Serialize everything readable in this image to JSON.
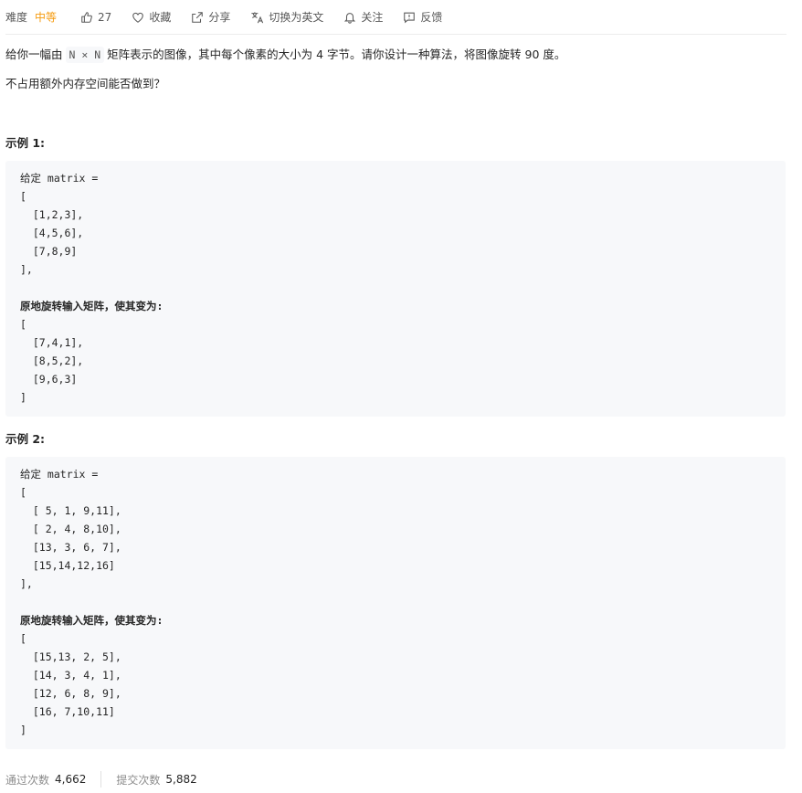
{
  "toolbar": {
    "difficulty_label": "难度",
    "difficulty_value": "中等",
    "likes": "27",
    "favorite": "收藏",
    "share": "分享",
    "switch_lang": "切换为英文",
    "follow": "关注",
    "feedback": "反馈",
    "difficulty_color": "#f59b0f"
  },
  "description": {
    "part1": "给你一幅由",
    "code": "N × N",
    "part2": "矩阵表示的图像，其中每个像素的大小为 4 字节。请你设计一种算法，将图像旋转 90 度。",
    "line2": "不占用额外内存空间能否做到？"
  },
  "examples": [
    {
      "title": "示例 1:",
      "lines": [
        {
          "text": "给定 matrix =",
          "bold": false
        },
        {
          "text": "[",
          "bold": false
        },
        {
          "text": "  [1,2,3],",
          "bold": false
        },
        {
          "text": "  [4,5,6],",
          "bold": false
        },
        {
          "text": "  [7,8,9]",
          "bold": false
        },
        {
          "text": "],",
          "bold": false
        },
        {
          "text": "",
          "bold": false
        },
        {
          "text": "原地旋转输入矩阵，使其变为:",
          "bold": true
        },
        {
          "text": "[",
          "bold": false
        },
        {
          "text": "  [7,4,1],",
          "bold": false
        },
        {
          "text": "  [8,5,2],",
          "bold": false
        },
        {
          "text": "  [9,6,3]",
          "bold": false
        },
        {
          "text": "]",
          "bold": false
        }
      ]
    },
    {
      "title": "示例 2:",
      "lines": [
        {
          "text": "给定 matrix =",
          "bold": false
        },
        {
          "text": "[",
          "bold": false
        },
        {
          "text": "  [ 5, 1, 9,11],",
          "bold": false
        },
        {
          "text": "  [ 2, 4, 8,10],",
          "bold": false
        },
        {
          "text": "  [13, 3, 6, 7],",
          "bold": false
        },
        {
          "text": "  [15,14,12,16]",
          "bold": false
        },
        {
          "text": "],",
          "bold": false
        },
        {
          "text": "",
          "bold": false
        },
        {
          "text": "原地旋转输入矩阵，使其变为:",
          "bold": true
        },
        {
          "text": "[",
          "bold": false
        },
        {
          "text": "  [15,13, 2, 5],",
          "bold": false
        },
        {
          "text": "  [14, 3, 4, 1],",
          "bold": false
        },
        {
          "text": "  [12, 6, 8, 9],",
          "bold": false
        },
        {
          "text": "  [16, 7,10,11]",
          "bold": false
        },
        {
          "text": "]",
          "bold": false
        }
      ]
    }
  ],
  "stats": {
    "accepted_label": "通过次数",
    "accepted_value": "4,662",
    "submitted_label": "提交次数",
    "submitted_value": "5,882"
  }
}
